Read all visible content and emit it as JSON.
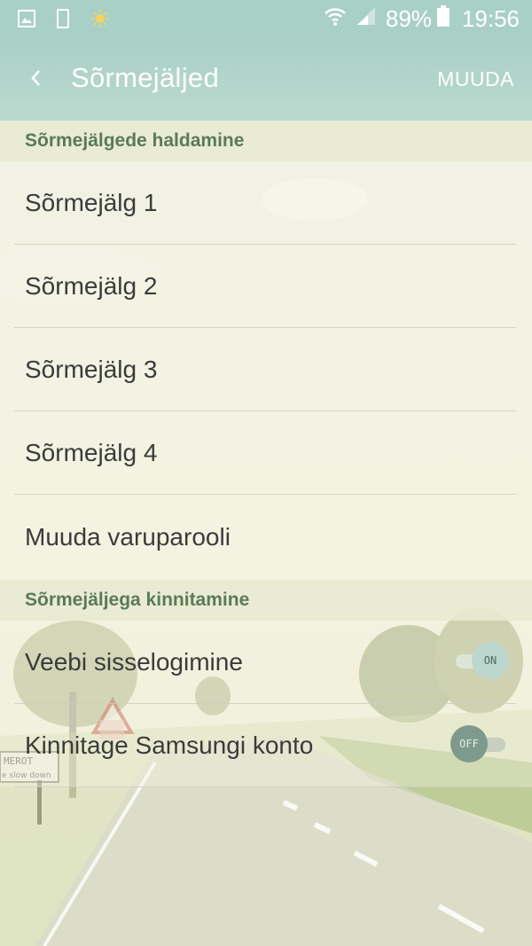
{
  "status_bar": {
    "icons": [
      "gallery-icon",
      "phone-outline-icon",
      "brightness-icon"
    ],
    "battery_percent": "89%",
    "time": "19:56"
  },
  "app_bar": {
    "title": "Sõrmejäljed",
    "action": "MUUDA"
  },
  "sections": {
    "manage_header": "Sõrmejälgede haldamine",
    "fingerprints": [
      "Sõrmejälg 1",
      "Sõrmejälg 2",
      "Sõrmejälg 3",
      "Sõrmejälg 4"
    ],
    "backup_password": "Muuda varuparooli",
    "verify_header": "Sõrmejäljega kinnitamine",
    "web_signin": {
      "label": "Veebi sisselogimine",
      "state": "ON"
    },
    "samsung_account": {
      "label": "Kinnitage Samsungi konto",
      "state": "OFF"
    }
  },
  "colors": {
    "header_bg": "#a9d0c6",
    "section_text": "#5a7a58",
    "item_text": "#3b3b3b"
  }
}
